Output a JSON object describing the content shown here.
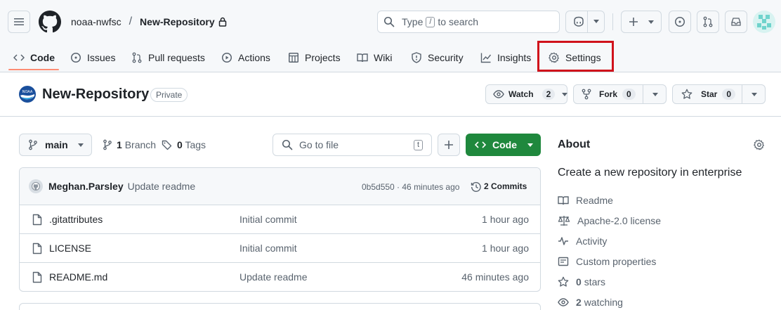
{
  "header": {
    "owner": "noaa-nwfsc",
    "separator": "/",
    "repo": "New-Repository",
    "search": {
      "prefix": "Type",
      "key": "/",
      "suffix": "to search"
    }
  },
  "tabs": [
    {
      "label": "Code",
      "icon": "code-icon",
      "active": true
    },
    {
      "label": "Issues",
      "icon": "issue-icon"
    },
    {
      "label": "Pull requests",
      "icon": "pull-request-icon"
    },
    {
      "label": "Actions",
      "icon": "play-icon"
    },
    {
      "label": "Projects",
      "icon": "table-icon"
    },
    {
      "label": "Wiki",
      "icon": "book-icon"
    },
    {
      "label": "Security",
      "icon": "shield-icon"
    },
    {
      "label": "Insights",
      "icon": "graph-icon"
    },
    {
      "label": "Settings",
      "icon": "gear-icon",
      "highlighted": true
    }
  ],
  "repo": {
    "title": "New-Repository",
    "visibility": "Private",
    "watch": {
      "label": "Watch",
      "count": "2"
    },
    "fork": {
      "label": "Fork",
      "count": "0"
    },
    "star": {
      "label": "Star",
      "count": "0"
    }
  },
  "files_toolbar": {
    "branch": "main",
    "branches": {
      "count": "1",
      "label": "Branch"
    },
    "tags": {
      "count": "0",
      "label": "Tags"
    },
    "goto_placeholder": "Go to file",
    "goto_key": "t",
    "code_button": "Code"
  },
  "latest_commit": {
    "author": "Meghan.Parsley",
    "message": "Update readme",
    "hash_time": "0b5d550 · 46 minutes ago",
    "commits": "2 Commits"
  },
  "files": [
    {
      "name": ".gitattributes",
      "message": "Initial commit",
      "time": "1 hour ago"
    },
    {
      "name": "LICENSE",
      "message": "Initial commit",
      "time": "1 hour ago"
    },
    {
      "name": "README.md",
      "message": "Update readme",
      "time": "46 minutes ago"
    }
  ],
  "about": {
    "title": "About",
    "description": "Create a new repository in enterprise",
    "items": [
      {
        "icon": "book-icon",
        "label": "Readme"
      },
      {
        "icon": "law-icon",
        "label": "Apache-2.0 license"
      },
      {
        "icon": "pulse-icon",
        "label": "Activity"
      },
      {
        "icon": "note-icon",
        "label": "Custom properties"
      },
      {
        "icon": "star-icon",
        "count": "0",
        "label": "stars"
      },
      {
        "icon": "eye-icon",
        "count": "2",
        "label": "watching"
      }
    ]
  },
  "colors": {
    "accent_green": "#1f883d",
    "highlight_red": "#d0121b",
    "tab_underline": "#fd8c73"
  }
}
